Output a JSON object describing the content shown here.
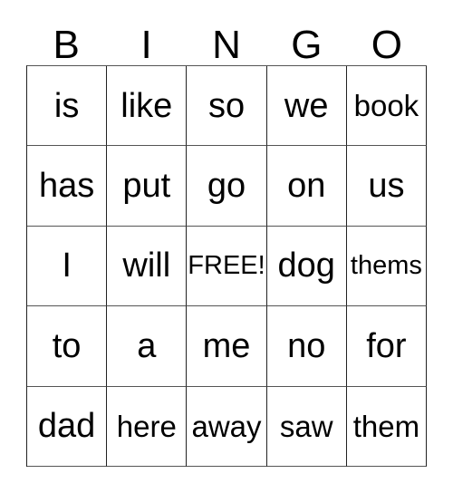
{
  "card": {
    "title": "BINGO",
    "headers": [
      "B",
      "I",
      "N",
      "G",
      "O"
    ],
    "free_space_label": "FREE!",
    "free_space_position": {
      "row": 2,
      "col": 2
    },
    "colors": {
      "background": "#ffffff",
      "text": "#000000",
      "grid_line": "#333333"
    },
    "grid": [
      [
        {
          "text": "is",
          "size": "normal",
          "free": false
        },
        {
          "text": "like",
          "size": "normal",
          "free": false
        },
        {
          "text": "so",
          "size": "normal",
          "free": false
        },
        {
          "text": "we",
          "size": "normal",
          "free": false
        },
        {
          "text": "book",
          "size": "md",
          "free": false
        }
      ],
      [
        {
          "text": "has",
          "size": "normal",
          "free": false
        },
        {
          "text": "put",
          "size": "normal",
          "free": false
        },
        {
          "text": "go",
          "size": "normal",
          "free": false
        },
        {
          "text": "on",
          "size": "normal",
          "free": false
        },
        {
          "text": "us",
          "size": "normal",
          "free": false
        }
      ],
      [
        {
          "text": "I",
          "size": "normal",
          "free": false
        },
        {
          "text": "will",
          "size": "normal",
          "free": false
        },
        {
          "text": "FREE!",
          "size": "sm",
          "free": true
        },
        {
          "text": "dog",
          "size": "normal",
          "free": false
        },
        {
          "text": "thems",
          "size": "sm",
          "free": false
        }
      ],
      [
        {
          "text": "to",
          "size": "normal",
          "free": false
        },
        {
          "text": "a",
          "size": "normal",
          "free": false
        },
        {
          "text": "me",
          "size": "normal",
          "free": false
        },
        {
          "text": "no",
          "size": "normal",
          "free": false
        },
        {
          "text": "for",
          "size": "normal",
          "free": false
        }
      ],
      [
        {
          "text": "dad",
          "size": "normal",
          "free": false
        },
        {
          "text": "here",
          "size": "md",
          "free": false
        },
        {
          "text": "away",
          "size": "md",
          "free": false
        },
        {
          "text": "saw",
          "size": "md",
          "free": false
        },
        {
          "text": "them",
          "size": "md",
          "free": false
        }
      ]
    ]
  }
}
